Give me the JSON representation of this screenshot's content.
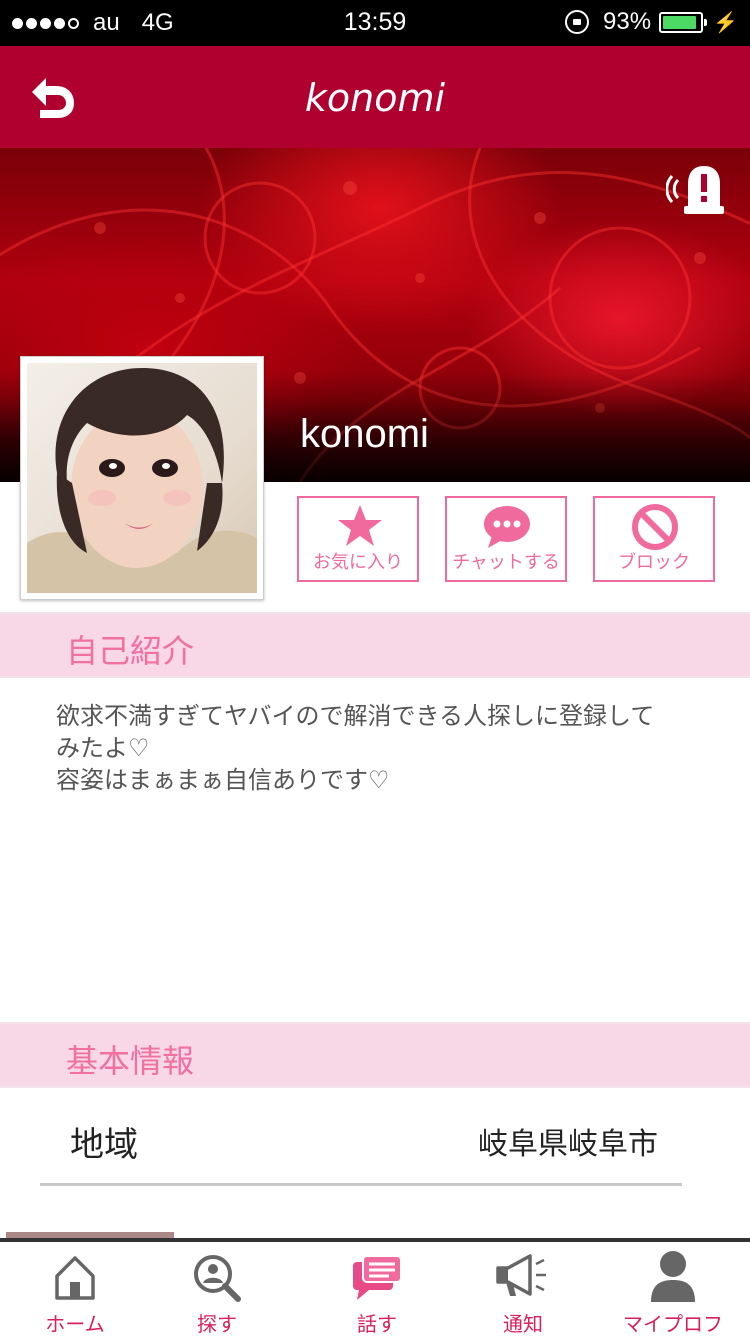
{
  "status_bar": {
    "carrier": "au",
    "network": "4G",
    "time": "13:59",
    "battery_percent": "93%",
    "battery_level": 0.93,
    "signal_dots_filled": 4
  },
  "header": {
    "title": "konomi",
    "back_icon": "back-arrow-icon",
    "color": "#b00030"
  },
  "profile": {
    "cover_name": "konomi",
    "report_icon": "alert-siren-icon",
    "avatar_icon": "profile-photo"
  },
  "actions": [
    {
      "label": "お気に入り",
      "icon": "star-icon"
    },
    {
      "label": "チャットする",
      "icon": "chat-bubble-icon"
    },
    {
      "label": "ブロック",
      "icon": "block-icon"
    }
  ],
  "intro_section": {
    "title": "自己紹介",
    "text": "欲求不満すぎてヤバイので解消できる人探しに登録して\nみたよ♡\n容姿はまぁまぁ自信ありです♡"
  },
  "basic_info_section": {
    "title": "基本情報",
    "rows": [
      {
        "key": "地域",
        "value": "岐阜県岐阜市"
      }
    ]
  },
  "tab_bar": {
    "accent": "#d81e5b",
    "tabs": [
      {
        "label": "ホーム",
        "icon": "home-icon"
      },
      {
        "label": "探す",
        "icon": "search-user-icon"
      },
      {
        "label": "話す",
        "icon": "chat-icon"
      },
      {
        "label": "通知",
        "icon": "megaphone-icon"
      },
      {
        "label": "マイプロフ",
        "icon": "person-icon"
      }
    ]
  }
}
